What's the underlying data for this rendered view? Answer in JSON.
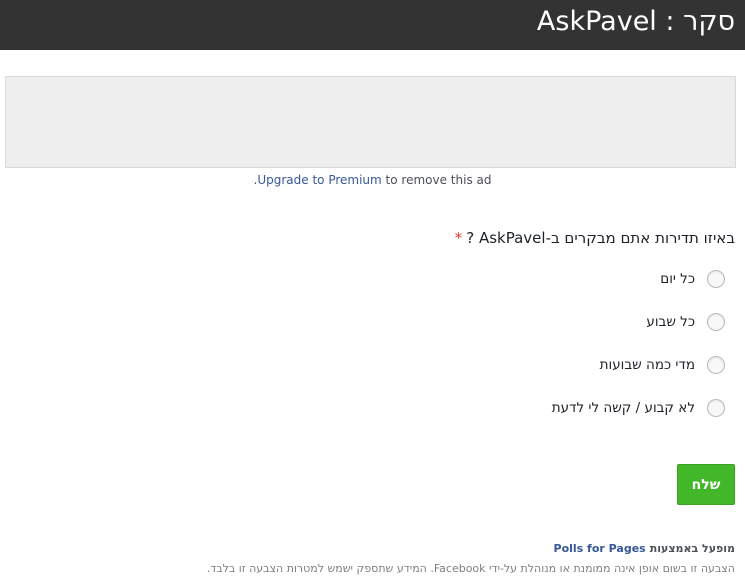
{
  "header": {
    "title": "סקר : AskPavel"
  },
  "ad": {
    "upgrade_link": "Upgrade to Premium",
    "upgrade_suffix": " to remove this ad",
    "dot": "."
  },
  "poll": {
    "question": "באיזו תדירות אתם מבקרים ב-AskPavel ?",
    "required_mark": "*",
    "options": [
      {
        "label": "כל יום"
      },
      {
        "label": "כל שבוע"
      },
      {
        "label": "מדי כמה שבועות"
      },
      {
        "label": "לא קבוע / קשה לי לדעת"
      }
    ],
    "submit_label": "שלח"
  },
  "footer": {
    "powered_by": "מופעל באמצעות",
    "powered_link": "Polls for Pages",
    "disclaimer": "הצבעה זו בשום אופן אינה ממומנת או מנוהלת על-ידי Facebook. המידע שתספק ישמש למטרות הצבעה זו בלבד."
  },
  "colors": {
    "header_bg": "#333333",
    "link": "#365899",
    "submit": "#42b72a",
    "required": "#e0442a"
  }
}
